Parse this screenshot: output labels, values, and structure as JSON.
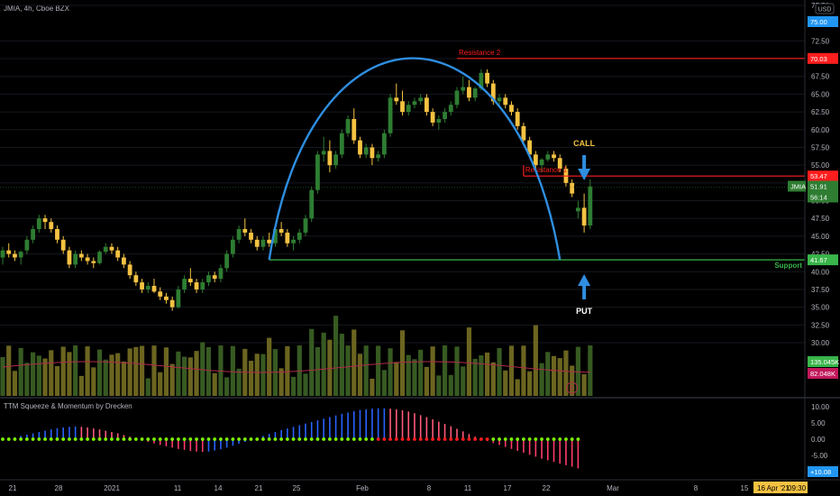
{
  "header": {
    "title": "JMIA, 4h, Cboe BZX",
    "currency": "USD"
  },
  "indicator": {
    "title": "TTM Squeeze & Momentum by Drecken"
  },
  "colors": {
    "up": "#2e7d32",
    "down": "#f5c242",
    "resistance": "#ff1e1e",
    "support": "#39b54a",
    "arc": "#2f8ee0",
    "arrow": "#2f8ee0",
    "call": "#f5c242",
    "put": "#ffffff",
    "vol_up": "#375a22",
    "vol_down": "#6b6520"
  },
  "annotations": {
    "resistance2": "Resistance 2",
    "resistance1": "Resistance 1",
    "support": "Support",
    "call": "CALL",
    "put": "PUT",
    "e_badge": "E"
  },
  "price_axis": {
    "ticks": [
      "77.50",
      "72.50",
      "70.00",
      "67.50",
      "65.00",
      "62.50",
      "60.00",
      "57.50",
      "55.00",
      "52.50",
      "50.00",
      "47.50",
      "45.00",
      "42.50",
      "40.00",
      "37.50",
      "35.00",
      "32.50",
      "30.00"
    ],
    "top_tag": "75.00",
    "res2_tag": "70.03",
    "res1_tag": "53.47",
    "ticker_tag": "JMIA",
    "last_tag": "51.91",
    "timer_tag": "56:14",
    "support_tag": "41.67",
    "vol_tag1": "135.045K",
    "vol_tag2": "82.048K"
  },
  "osc_axis": {
    "ticks": [
      "10.00",
      "5.00",
      "0.00",
      "-5.00"
    ],
    "value_tag": "+10.08"
  },
  "time_axis": {
    "labels": [
      "21",
      "28",
      "2021",
      "11",
      "14",
      "21",
      "25",
      "Feb",
      "8",
      "11",
      "17",
      "22",
      "Mar",
      "8",
      "15"
    ],
    "current_date": "16 Apr '21",
    "current_time": "09:30"
  },
  "chart_data": {
    "type": "candlestick",
    "symbol": "JMIA",
    "interval": "4h",
    "ylim": [
      30,
      77.5
    ],
    "candles": [
      [
        42,
        43.5,
        41,
        43
      ],
      [
        43,
        44,
        42,
        42.5
      ],
      [
        42.5,
        43,
        41.5,
        42
      ],
      [
        42,
        43,
        41,
        42.8
      ],
      [
        43,
        45,
        42.5,
        44.5
      ],
      [
        44.5,
        46.5,
        44,
        46
      ],
      [
        46,
        48,
        45.5,
        47.5
      ],
      [
        47.5,
        48,
        46,
        47
      ],
      [
        47,
        47.5,
        45.5,
        46
      ],
      [
        46,
        46.5,
        44,
        44.5
      ],
      [
        44.5,
        45,
        42.5,
        43
      ],
      [
        43,
        43.5,
        40.5,
        41
      ],
      [
        41,
        43,
        40.5,
        42.5
      ],
      [
        42.5,
        43,
        41.5,
        42
      ],
      [
        42,
        42.5,
        41,
        41.5
      ],
      [
        41.5,
        42,
        40.5,
        41.2
      ],
      [
        41.2,
        43,
        41,
        42.8
      ],
      [
        42.8,
        44,
        42.5,
        43.5
      ],
      [
        43.5,
        44,
        42.5,
        43
      ],
      [
        43,
        43.5,
        41.5,
        42
      ],
      [
        42,
        42.5,
        40.5,
        41
      ],
      [
        41,
        41.5,
        39,
        39.5
      ],
      [
        39.5,
        40,
        38,
        38.5
      ],
      [
        38.5,
        39,
        37,
        37.5
      ],
      [
        37.5,
        38.5,
        37,
        38
      ],
      [
        38,
        39,
        37,
        37.2
      ],
      [
        37.2,
        37.8,
        36,
        36.5
      ],
      [
        36.5,
        37,
        35.5,
        36
      ],
      [
        36,
        36.5,
        34.5,
        35
      ],
      [
        35,
        38,
        34.8,
        37.5
      ],
      [
        37.5,
        39.5,
        37,
        39
      ],
      [
        39,
        40.5,
        38,
        38.5
      ],
      [
        38.5,
        39,
        37,
        37.5
      ],
      [
        37.5,
        39,
        37,
        38.5
      ],
      [
        38.5,
        40,
        38,
        39.5
      ],
      [
        39.5,
        40,
        38.5,
        39
      ],
      [
        39,
        41,
        38.5,
        40.5
      ],
      [
        40.5,
        43,
        40,
        42.5
      ],
      [
        42.5,
        45,
        42,
        44.5
      ],
      [
        44.5,
        46.5,
        44,
        46
      ],
      [
        46,
        47.5,
        45,
        45.5
      ],
      [
        45.5,
        46,
        44,
        44.5
      ],
      [
        44.5,
        45,
        43,
        43.5
      ],
      [
        43.5,
        45,
        43,
        44.5
      ],
      [
        44.5,
        45.5,
        43.5,
        44
      ],
      [
        44,
        46.5,
        43.5,
        46
      ],
      [
        46,
        47,
        45,
        45.5
      ],
      [
        45.5,
        46,
        43.5,
        44
      ],
      [
        44,
        45,
        43,
        44.5
      ],
      [
        44.5,
        46,
        44,
        45.5
      ],
      [
        45.5,
        48,
        45,
        47.5
      ],
      [
        47.5,
        52,
        47,
        51.5
      ],
      [
        51.5,
        57,
        51,
        56.5
      ],
      [
        56.5,
        59,
        55.5,
        57
      ],
      [
        57,
        58.5,
        54,
        55
      ],
      [
        55,
        57,
        54.5,
        56.5
      ],
      [
        56.5,
        60,
        56,
        59.5
      ],
      [
        59.5,
        62,
        59,
        61.5
      ],
      [
        61.5,
        63,
        58,
        58.5
      ],
      [
        58.5,
        59,
        56,
        56.5
      ],
      [
        56.5,
        58,
        56,
        57.5
      ],
      [
        57.5,
        58,
        55,
        56
      ],
      [
        56,
        57,
        55.5,
        56.5
      ],
      [
        56.5,
        60,
        56,
        59.5
      ],
      [
        59.5,
        65,
        59,
        64.5
      ],
      [
        64.5,
        66.5,
        63.5,
        64
      ],
      [
        64,
        65.5,
        62,
        62.5
      ],
      [
        62.5,
        64,
        62,
        63.5
      ],
      [
        63.5,
        64.5,
        63,
        64
      ],
      [
        64,
        65,
        63.5,
        64.5
      ],
      [
        64.5,
        65,
        62,
        62.5
      ],
      [
        62.5,
        63,
        60.5,
        61
      ],
      [
        61,
        62,
        60,
        61.5
      ],
      [
        61.5,
        63,
        61,
        62.5
      ],
      [
        62.5,
        64,
        62,
        63.5
      ],
      [
        63.5,
        66,
        63,
        65.5
      ],
      [
        65.5,
        67.5,
        65,
        66
      ],
      [
        66,
        67,
        64,
        64.5
      ],
      [
        64.5,
        66,
        64,
        65.8
      ],
      [
        65.8,
        68.5,
        65.5,
        68
      ],
      [
        68,
        68.5,
        66,
        66.5
      ],
      [
        66.5,
        67,
        63.5,
        64
      ],
      [
        64,
        65,
        63.5,
        64.5
      ],
      [
        64.5,
        65,
        63,
        63.5
      ],
      [
        63.5,
        64,
        62,
        62.5
      ],
      [
        62.5,
        63,
        60,
        60.5
      ],
      [
        60.5,
        61,
        58,
        58.5
      ],
      [
        58.5,
        59,
        56,
        56.5
      ],
      [
        56.5,
        57,
        54.5,
        55
      ],
      [
        55,
        56,
        54,
        55.8
      ],
      [
        55.8,
        57,
        55.5,
        56.5
      ],
      [
        56.5,
        57,
        55.5,
        56
      ],
      [
        56,
        56.5,
        54,
        54.5
      ],
      [
        54.5,
        55,
        52,
        52.5
      ],
      [
        52.5,
        53,
        50.5,
        51
      ],
      [
        48.5,
        50,
        47.5,
        49
      ],
      [
        49,
        51,
        45.5,
        46.5
      ],
      [
        46.5,
        53,
        46,
        52
      ]
    ],
    "volume_series": [
      {
        "name": "Volume MA 1",
        "value": 135045
      },
      {
        "name": "Volume MA 2",
        "value": 82048
      }
    ],
    "resistance_levels": [
      70.03,
      53.47
    ],
    "support_levels": [
      41.67
    ],
    "momentum_range": [
      -10,
      12.5
    ],
    "momentum": [
      0,
      0.3,
      0.6,
      1,
      1.4,
      1.8,
      2.2,
      2.6,
      3,
      3.4,
      3.6,
      3.8,
      3.9,
      3.8,
      3.6,
      3.3,
      3,
      2.6,
      2.2,
      1.8,
      1.3,
      0.8,
      0.3,
      -0.3,
      -0.8,
      -1.3,
      -1.8,
      -2.2,
      -2.6,
      -3,
      -3.3,
      -3.6,
      -3.8,
      -3.9,
      -3.8,
      -3.5,
      -3.1,
      -2.6,
      -2,
      -1.4,
      -0.8,
      -0.2,
      0.4,
      1,
      1.6,
      2.2,
      2.8,
      3.3,
      3.8,
      4.3,
      4.8,
      5.3,
      5.8,
      6.3,
      6.8,
      7.3,
      7.8,
      8.2,
      8.6,
      9,
      9.2,
      9.4,
      9.5,
      9.5,
      9.4,
      9.2,
      8.9,
      8.5,
      8,
      7.4,
      6.8,
      6.1,
      5.4,
      4.7,
      4,
      3.2,
      2.4,
      1.6,
      0.8,
      0,
      -0.6,
      -1.2,
      -1.8,
      -2.4,
      -3,
      -3.6,
      -4.2,
      -4.8,
      -5.4,
      -6,
      -6.5,
      -7,
      -7.5,
      -8,
      -8.5,
      -9
    ]
  }
}
